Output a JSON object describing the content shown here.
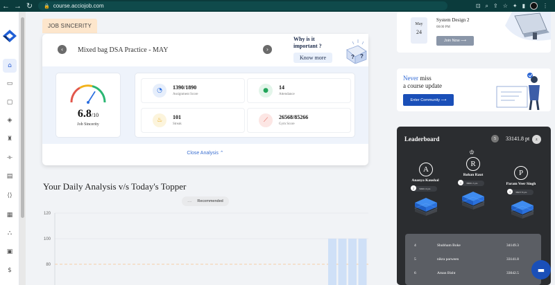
{
  "browser": {
    "url": "course.acciojob.com",
    "back_icon": "back-arrow-icon",
    "forward_icon": "forward-arrow-icon",
    "reload_icon": "reload-icon"
  },
  "sidebar": {
    "items": [
      {
        "name": "home",
        "icon": "home-icon",
        "active": true
      },
      {
        "name": "courses",
        "icon": "book-icon"
      },
      {
        "name": "messages",
        "icon": "chat-icon"
      },
      {
        "name": "layers",
        "icon": "layers-icon"
      },
      {
        "name": "trophy",
        "icon": "trophy-icon"
      },
      {
        "name": "fitness",
        "icon": "dumbbell-icon"
      },
      {
        "name": "documents",
        "icon": "document-icon"
      },
      {
        "name": "code",
        "icon": "code-icon"
      },
      {
        "name": "calendar",
        "icon": "calendar-icon"
      },
      {
        "name": "network",
        "icon": "network-icon"
      },
      {
        "name": "calculator",
        "icon": "calculator-icon"
      },
      {
        "name": "payments",
        "icon": "dollar-icon"
      }
    ]
  },
  "job_sincerity": {
    "tab_label": "JOB SINCERITY",
    "practice_title": "Mixed bag DSA Practice - MAY",
    "why_text_line1": "Why is it",
    "why_text_line2": "important ?",
    "know_more": "Know more",
    "score": "6.8",
    "score_max": "/10",
    "score_fraction": 0.68,
    "score_label": "Job Sincerity",
    "stats": [
      {
        "value": "1390/1890",
        "label": "Assignment Score",
        "icon": "pie-chart-icon",
        "color": "#2c6fe0",
        "bg": "#e6eefb"
      },
      {
        "value": "14",
        "label": "Attendance",
        "icon": "person-icon",
        "color": "#22a55a",
        "bg": "#e3f5ea"
      },
      {
        "value": "101",
        "label": "Streak",
        "icon": "flame-icon",
        "color": "#e8a20a",
        "bg": "#fcf4dc"
      },
      {
        "value": "26568/85266",
        "label": "Gym Score",
        "icon": "dumbbell-icon",
        "color": "#e2574c",
        "bg": "#fce6e4"
      }
    ],
    "close_analysis": "Close Analysis ⌃"
  },
  "daily_analysis": {
    "title": "Your Daily Analysis v/s Today's Topper",
    "filter_label": "Recommended",
    "filter_prefix": "....",
    "chart_data": {
      "type": "bar",
      "ylim": [
        60,
        120
      ],
      "yticks": [
        "120",
        "100",
        "80"
      ],
      "reference_line": 80,
      "bars_visible": [
        100,
        100,
        100,
        100
      ],
      "colors": {
        "bar": "#cfe0f7",
        "grid": "#e5e7eb",
        "reference": "#f6c08a"
      }
    }
  },
  "event": {
    "month": "May",
    "day": "24",
    "title": "System Design 2",
    "time": "08:00 PM",
    "join_label": "Join Now ⟶"
  },
  "update": {
    "line1_blue": "Never",
    "line1_rest": " miss",
    "line2": "a course update",
    "button": "Enter Community ⟶"
  },
  "leaderboard": {
    "title": "Leaderboard",
    "my_rank": "5",
    "my_points": "33141.8 pt",
    "z_label": "z",
    "top3": [
      {
        "initial": "A",
        "name": "Ananya Kaushal",
        "rank": "2",
        "points": "34961.9 pts"
      },
      {
        "initial": "R",
        "name": "Rohan Raut",
        "rank": "1",
        "points": "38681.5 pts"
      },
      {
        "initial": "P",
        "name": "Param Veer Singh",
        "rank": "3",
        "points": "36937.8 pts"
      }
    ],
    "rows": [
      {
        "rank": "4",
        "name": "Shubham Boke",
        "points": "34149.3"
      },
      {
        "rank": "5",
        "name": "nikra parween",
        "points": "33141.8"
      },
      {
        "rank": "6",
        "name": "Aman Bisht",
        "points": "33042.5"
      }
    ]
  },
  "chat": {
    "icon": "chat-bubble-icon"
  }
}
